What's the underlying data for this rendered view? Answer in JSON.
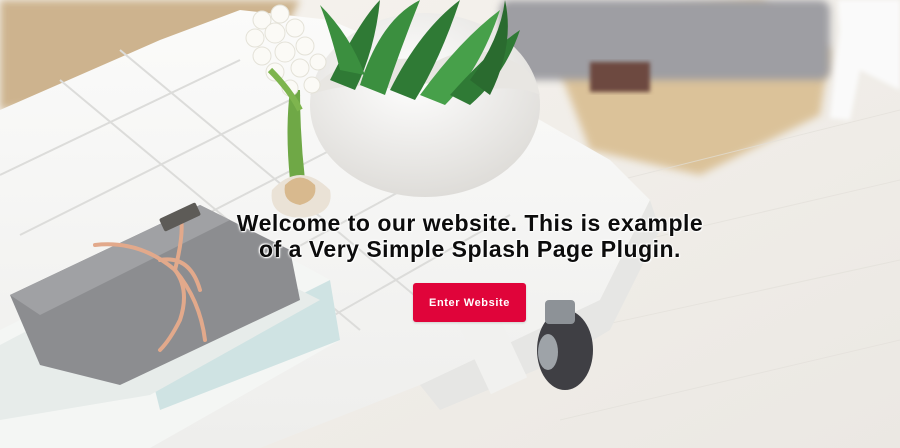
{
  "splash": {
    "headline_line1": "Welcome to our website. This is example",
    "headline_line2": "of a Very Simple Splash Page Plugin.",
    "enter_button_label": "Enter Website"
  },
  "colors": {
    "button_background": "#e0043a",
    "button_text": "#ffffff",
    "headline_text": "#0c0c0c"
  }
}
